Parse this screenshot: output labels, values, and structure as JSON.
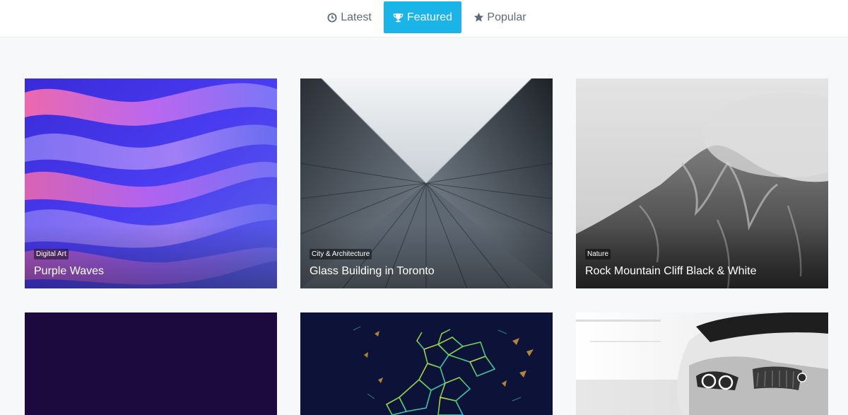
{
  "nav": {
    "tabs": [
      {
        "label": "Latest",
        "icon": "clock-icon",
        "active": false
      },
      {
        "label": "Featured",
        "icon": "trophy-icon",
        "active": true
      },
      {
        "label": "Popular",
        "icon": "star-icon",
        "active": false
      }
    ],
    "active_color": "#1ab4e8",
    "text_color": "#5c6b7a"
  },
  "gallery": {
    "cards": [
      {
        "category": "Digital Art",
        "title": "Purple Waves"
      },
      {
        "category": "City & Architecture",
        "title": "Glass Building in Toronto"
      },
      {
        "category": "Nature",
        "title": "Rock Mountain Cliff Black & White"
      },
      {
        "category": "",
        "title": ""
      },
      {
        "category": "",
        "title": ""
      },
      {
        "category": "",
        "title": ""
      }
    ]
  }
}
